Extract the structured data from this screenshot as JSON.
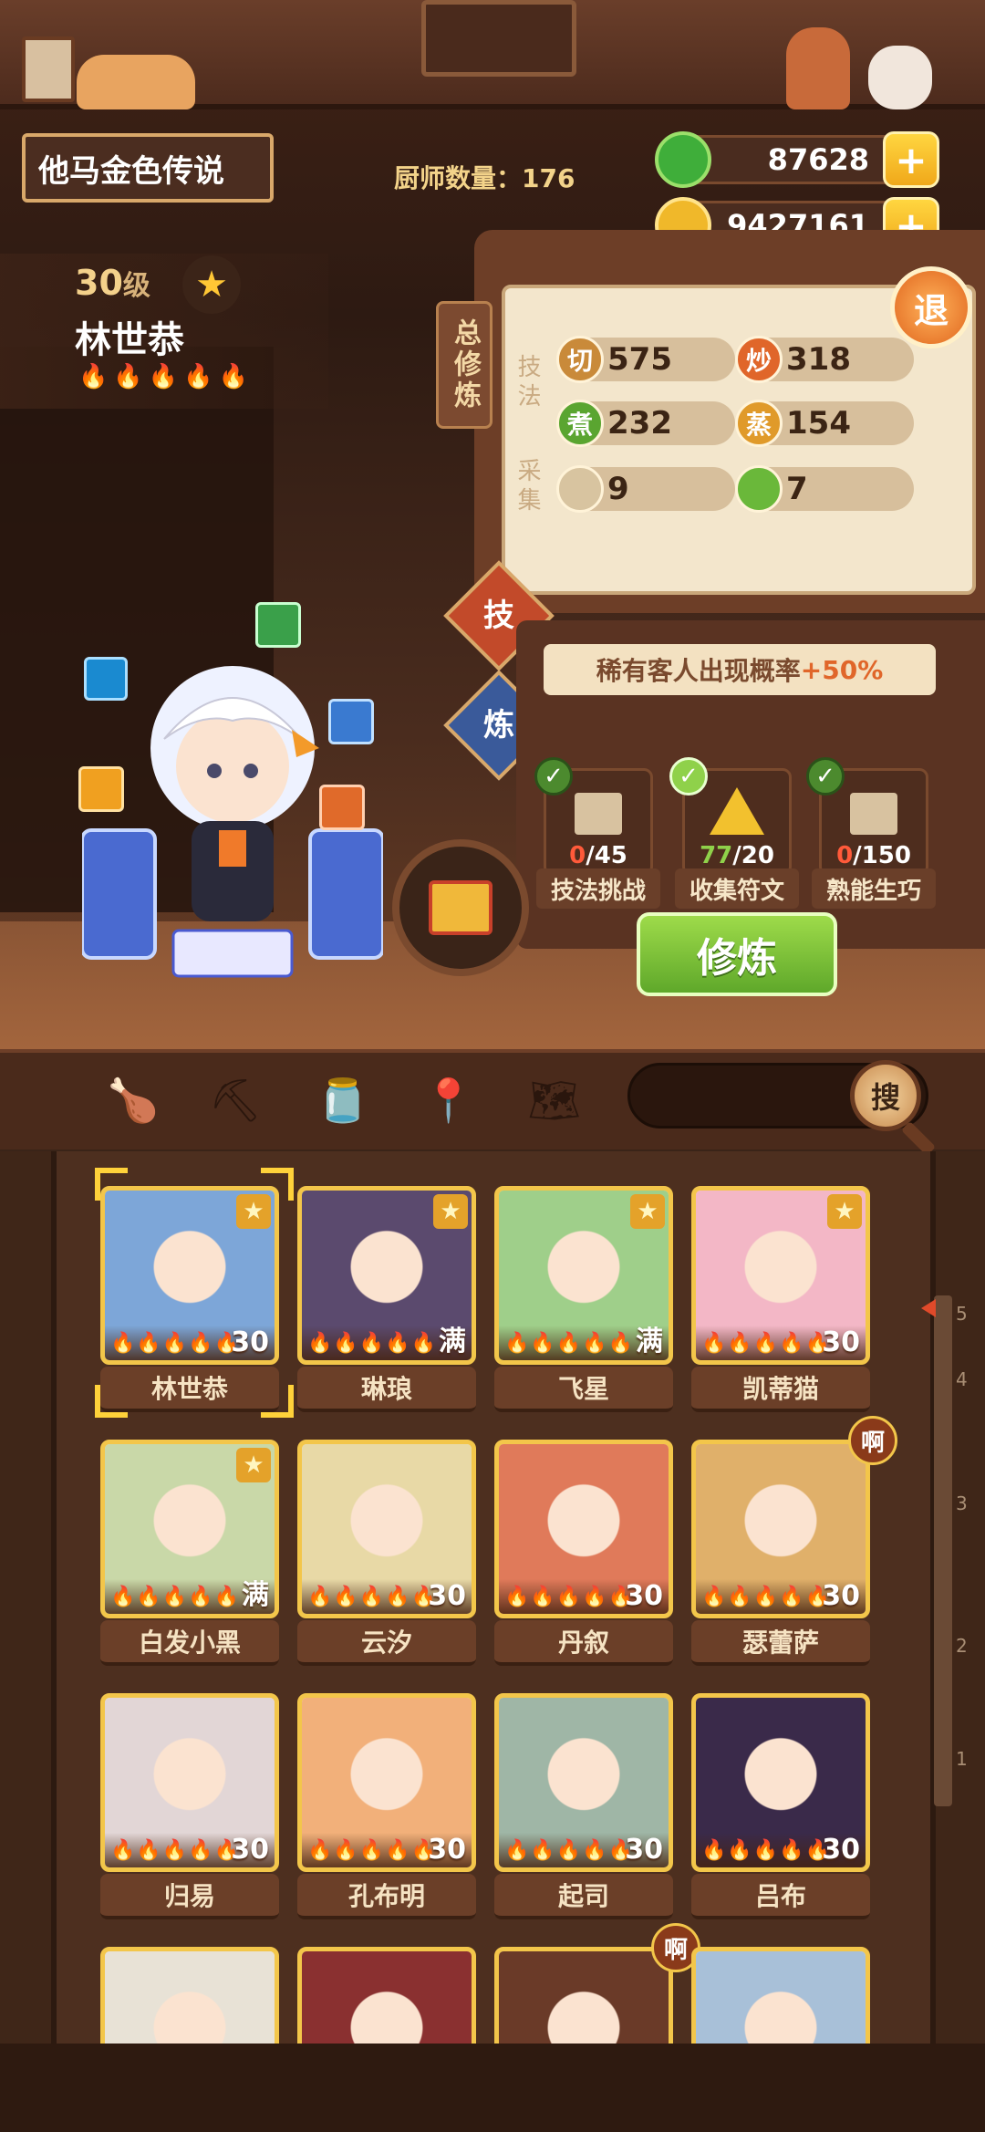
{
  "header": {
    "player_name": "他马金色传说",
    "chef_count_label": "厨师数量：",
    "chef_count": "176",
    "jade": "87628",
    "coins": "9427161",
    "plus": "+"
  },
  "chef": {
    "level": "30",
    "level_unit": "级",
    "name": "林世恭",
    "flames": "🔥🔥🔥🔥🔥"
  },
  "stats_panel": {
    "tab_label": "总修炼",
    "skill_label": "技法",
    "gather_label": "采集",
    "exit_label": "退",
    "stats": [
      {
        "icon_text": "切",
        "value": "575",
        "color": "#c98a3a"
      },
      {
        "icon_text": "炒",
        "value": "318",
        "color": "#e0662a"
      },
      {
        "icon_text": "煮",
        "value": "232",
        "color": "#5aa530"
      },
      {
        "icon_text": "蒸",
        "value": "154",
        "color": "#e09a2a"
      },
      {
        "icon_text": "",
        "value": "9",
        "color": "#d8c4a0"
      },
      {
        "icon_text": "",
        "value": "7",
        "color": "#6ab83a"
      }
    ]
  },
  "side_buttons": {
    "skill": "技",
    "train": "炼"
  },
  "banner": {
    "text": "稀有客人出现概率",
    "value": "+50%"
  },
  "tasks": [
    {
      "count": "0",
      "total": "/45",
      "label": "技法挑战",
      "done": false
    },
    {
      "count": "77",
      "total": "/20",
      "label": "收集符文",
      "done": true
    },
    {
      "count": "0",
      "total": "/150",
      "label": "熟能生巧",
      "done": false
    }
  ],
  "train_button": "修炼",
  "search": {
    "button": "搜"
  },
  "toolbar_icons": [
    "drumstick-icon",
    "shovel-icon",
    "jar-icon",
    "location-icon",
    "map-question-icon"
  ],
  "chefs": [
    {
      "name": "林世恭",
      "level": "30",
      "starred": true,
      "color": "#7da6d8",
      "selected": true
    },
    {
      "name": "琳琅",
      "level": "满",
      "starred": true,
      "color": "#5b4a6e"
    },
    {
      "name": "飞星",
      "level": "满",
      "starred": true,
      "color": "#9fcf8a"
    },
    {
      "name": "凯蒂猫",
      "level": "30",
      "starred": true,
      "color": "#f3b7c6"
    },
    {
      "name": "白发小黑",
      "level": "满",
      "starred": true,
      "color": "#c9d8a8"
    },
    {
      "name": "云汐",
      "level": "30",
      "starred": false,
      "color": "#e8d9a6"
    },
    {
      "name": "丹叙",
      "level": "30",
      "starred": false,
      "color": "#e07a5a"
    },
    {
      "name": "瑟蕾萨",
      "level": "30",
      "starred": false,
      "color": "#e0b06a",
      "badge": "啊"
    },
    {
      "name": "归易",
      "level": "30",
      "starred": false,
      "color": "#e2d6d6"
    },
    {
      "name": "孔布明",
      "level": "30",
      "starred": false,
      "color": "#f2b07a"
    },
    {
      "name": "起司",
      "level": "30",
      "starred": false,
      "color": "#9fb6a6"
    },
    {
      "name": "吕布",
      "level": "30",
      "starred": false,
      "color": "#3a2a4a"
    },
    {
      "name": "",
      "level": "",
      "starred": false,
      "color": "#e8e2d6"
    },
    {
      "name": "",
      "level": "",
      "starred": false,
      "color": "#8a3030"
    },
    {
      "name": "",
      "level": "",
      "starred": false,
      "color": "#6a3a28",
      "badge": "啊"
    },
    {
      "name": "",
      "level": "",
      "starred": false,
      "color": "#a8c0d8"
    }
  ],
  "scale_marks": [
    "5",
    "4",
    "3",
    "2",
    "1"
  ]
}
